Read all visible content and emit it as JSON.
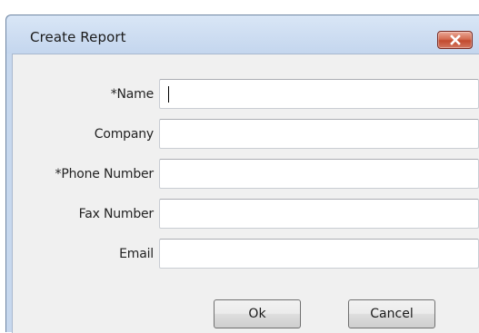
{
  "window": {
    "title": "Create Report"
  },
  "form": {
    "fields": [
      {
        "label": "*Name",
        "value": ""
      },
      {
        "label": "Company",
        "value": ""
      },
      {
        "label": "*Phone Number",
        "value": ""
      },
      {
        "label": "Fax Number",
        "value": ""
      },
      {
        "label": "Email",
        "value": ""
      }
    ]
  },
  "buttons": {
    "ok_label": "Ok",
    "cancel_label": "Cancel"
  },
  "icons": {
    "close": "close-icon"
  },
  "colors": {
    "title_bar": "#c7d8ee",
    "close_button": "#c9553a",
    "client_bg": "#f0f0f0"
  }
}
